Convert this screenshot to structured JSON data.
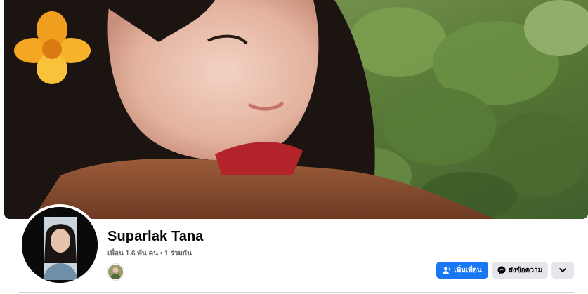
{
  "profile": {
    "name": "Suparlak Tana",
    "meta": "เพื่อน 1.6 พัน คน • 1 ร่วมกัน"
  },
  "actions": {
    "add_friend": "เพิ่มเพื่อน",
    "message": "ส่งข้อความ"
  },
  "icons": {
    "add_friend": "add-friend-icon",
    "message": "messenger-icon",
    "more": "chevron-down-icon"
  },
  "colors": {
    "primary": "#1877f2",
    "secondary_bg": "#e4e6eb",
    "meta_text": "#65676b"
  }
}
